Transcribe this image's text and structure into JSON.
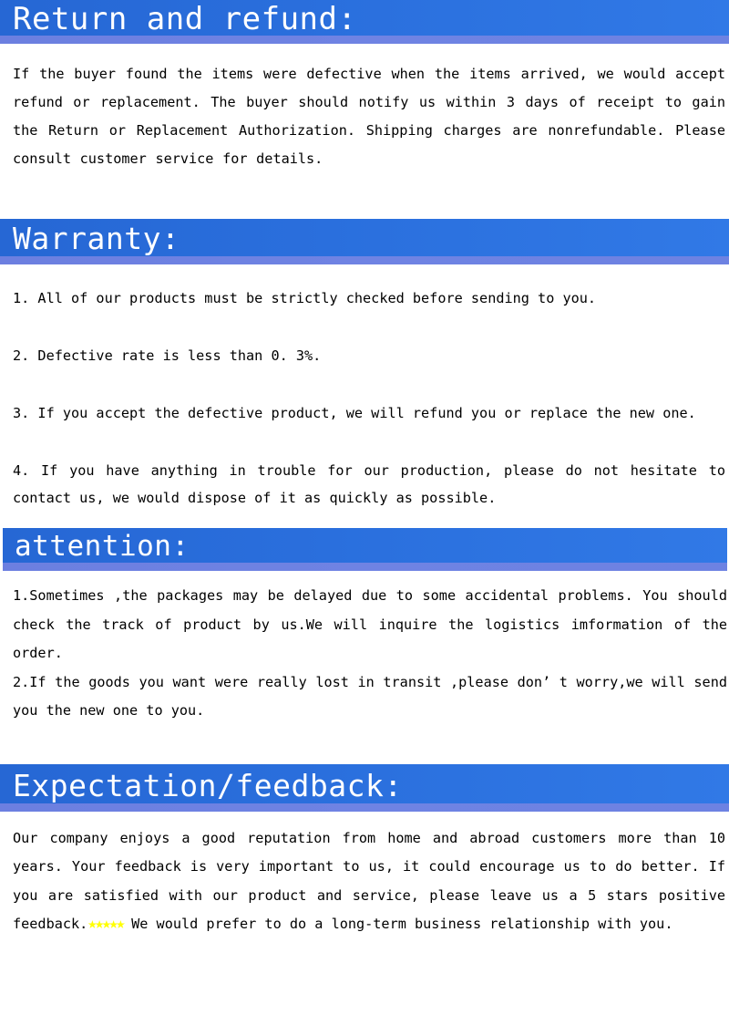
{
  "page": {
    "background_color": "#ffffff",
    "text_color": "#000000"
  },
  "theme": {
    "banner_blue": "#2a6fdd",
    "banner_strip_periwinkle": "#6f83e3",
    "star_yellow": "#ffff00"
  },
  "sections": {
    "return": {
      "heading": "Return and refund:",
      "paragraph": "If the buyer found the items were defective when the items arrived, we would accept refund or replacement. The buyer should notify us within 3 days of receipt to gain the Return or Replacement Authorization. Shipping charges are nonrefundable. Please consult customer service for details."
    },
    "warranty": {
      "heading": "Warranty:",
      "items": [
        "1. All of our products must be strictly checked before sending to you.",
        "2. Defective rate is less than 0. 3%.",
        "3. If you accept the defective product, we will refund you or replace the new one.",
        "4. If you have anything in trouble for our production, please do not hesitate to contact us, we would dispose of it as quickly as possible."
      ]
    },
    "attention": {
      "heading": "attention:",
      "items": [
        "1.Sometimes ,the packages may be delayed due to some accidental problems. You should check the track of product by us.We will inquire the logistics imformation of the order.",
        "2.If the goods you want were really lost in transit ,please don’ t worry,we will send you the new one to you."
      ]
    },
    "expectation": {
      "heading": "Expectation/feedback:",
      "paragraph_before_stars": "Our company enjoys a good reputation from home and abroad customers more than 10 years. Your feedback is very important to us, it could encourage us to do better. If you are satisfied with our product and service, please leave us a 5 stars positive feedback.",
      "stars": "★★★★★",
      "star_count": 5,
      "paragraph_after_stars": " We would prefer to do a long-term business relationship with you."
    }
  }
}
